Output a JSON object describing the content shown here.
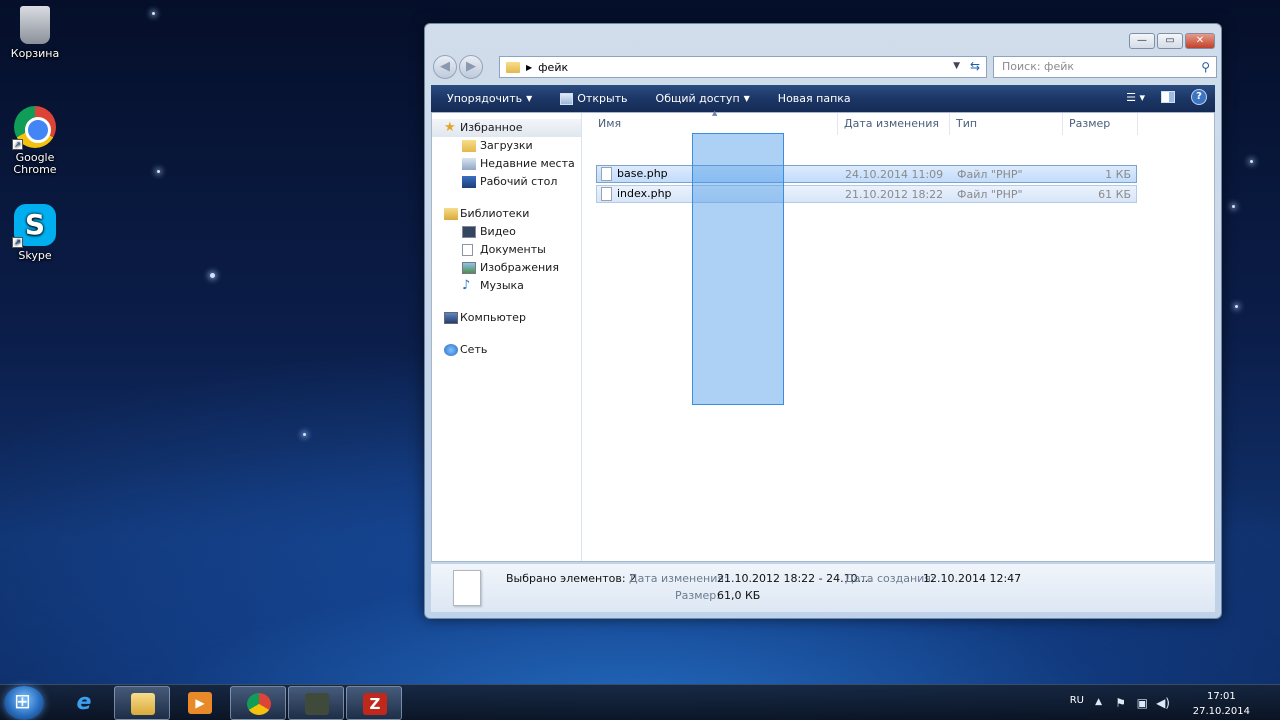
{
  "desktop": {
    "icons": [
      {
        "label": "Корзина"
      },
      {
        "label": "Google Chrome"
      },
      {
        "label": "Skype"
      }
    ]
  },
  "window": {
    "address": {
      "path": "фейк"
    },
    "search": {
      "placeholder": "Поиск: фейк"
    },
    "toolbar": {
      "organize": "Упорядочить",
      "open": "Открыть",
      "share": "Общий доступ",
      "new_folder": "Новая папка"
    },
    "nav": {
      "favorites": "Избранное",
      "downloads": "Загрузки",
      "recent": "Недавние места",
      "desktop": "Рабочий стол",
      "libraries": "Библиотеки",
      "video": "Видео",
      "documents": "Документы",
      "images": "Изображения",
      "music": "Музыка",
      "computer": "Компьютер",
      "network": "Сеть"
    },
    "columns": {
      "name": "Имя",
      "date": "Дата изменения",
      "type": "Тип",
      "size": "Размер"
    },
    "files": [
      {
        "name": "base.php",
        "date": "24.10.2014 11:09",
        "type": "Файл \"PHP\"",
        "size": "1 КБ"
      },
      {
        "name": "index.php",
        "date": "21.10.2012 18:22",
        "type": "Файл \"PHP\"",
        "size": "61 КБ"
      }
    ],
    "details": {
      "selected_label": "Выбрано элементов: 2",
      "modified_label": "Дата изменения:",
      "modified_value": "21.10.2012 18:22 - 24.10....",
      "created_label": "Дата создания:",
      "created_value": "12.10.2014 12:47",
      "size_label": "Размер:",
      "size_value": "61,0 КБ"
    }
  },
  "taskbar": {
    "lang": "RU",
    "time": "17:01",
    "date": "27.10.2014"
  }
}
